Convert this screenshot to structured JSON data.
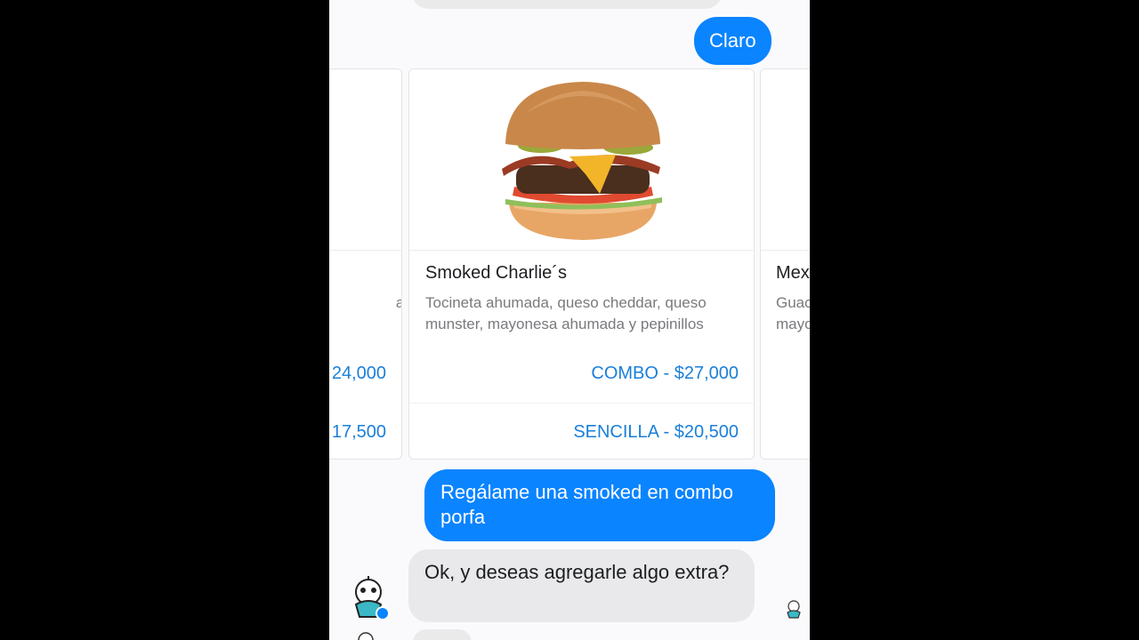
{
  "conversation": {
    "user_msg_1": "Claro",
    "user_msg_2": "Regálame una smoked en combo porfa",
    "bot_msg_1": "Ok, y deseas agregarle algo extra?"
  },
  "carousel": {
    "left_card": {
      "desc_fragment": "a,",
      "price_combo": "24,000",
      "price_sencilla": "17,500"
    },
    "main_card": {
      "title": "Smoked Charlie´s",
      "description": "Tocineta ahumada, queso cheddar, queso munster, mayonesa ahumada y pepinillos",
      "price_combo": "COMBO - $27,000",
      "price_sencilla": "SENCILLA - $20,500"
    },
    "right_card": {
      "title_fragment": "Mex",
      "desc_fragment": "Guac mayo"
    }
  },
  "colors": {
    "accent": "#0a84ff",
    "price": "#1a7fd9",
    "bubble_in": "#e9e9eb",
    "background": "#fafafc"
  }
}
